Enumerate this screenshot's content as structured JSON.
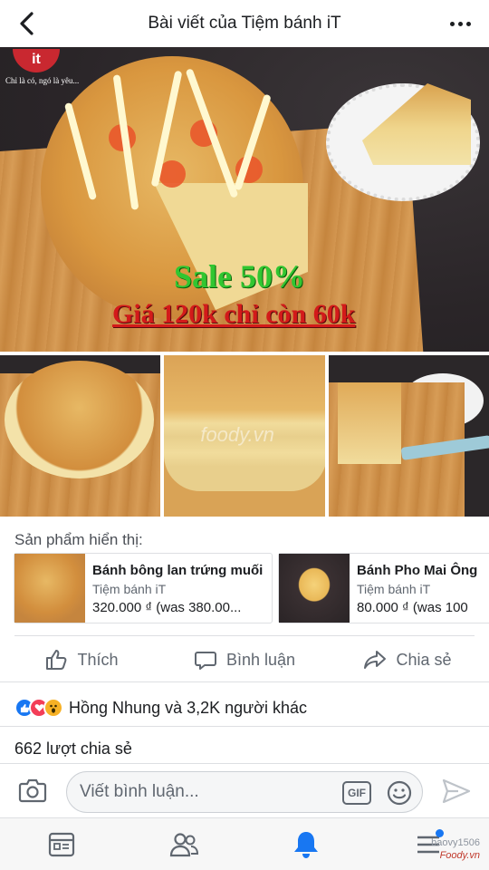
{
  "header": {
    "title": "Bài viết của Tiệm bánh iT"
  },
  "photo": {
    "logo": "it",
    "tagline": "Chỉ là có, ngó là yêu...",
    "sale_text": "Sale 50%",
    "price_text": "Giá 120k chỉ còn 60k"
  },
  "thumbs": {
    "watermark": "foody.vn"
  },
  "products": {
    "label": "Sản phẩm hiển thị:",
    "items": [
      {
        "name": "Bánh bông lan trứng muối",
        "shop": "Tiệm bánh iT",
        "price": "320.000 ₫ (was 380.00..."
      },
      {
        "name": "Bánh Pho Mai Ông",
        "shop": "Tiệm bánh iT",
        "price": "80.000 ₫ (was 100"
      }
    ]
  },
  "actions": {
    "like": "Thích",
    "comment": "Bình luận",
    "share": "Chia sẻ"
  },
  "reactions": {
    "text": "Hồng Nhung và 3,2K người khác"
  },
  "shares": {
    "text": "662 lượt chia sẻ"
  },
  "comment": {
    "placeholder": "Viết bình luận...",
    "gif": "GIF"
  },
  "credit": {
    "user": "baovy1506",
    "site": "Foody.vn"
  },
  "colors": {
    "accent": "#1877f2",
    "sale_green": "#31c631",
    "price_red": "#d31a1a",
    "love": "#f33e58",
    "wow": "#f7b125"
  }
}
